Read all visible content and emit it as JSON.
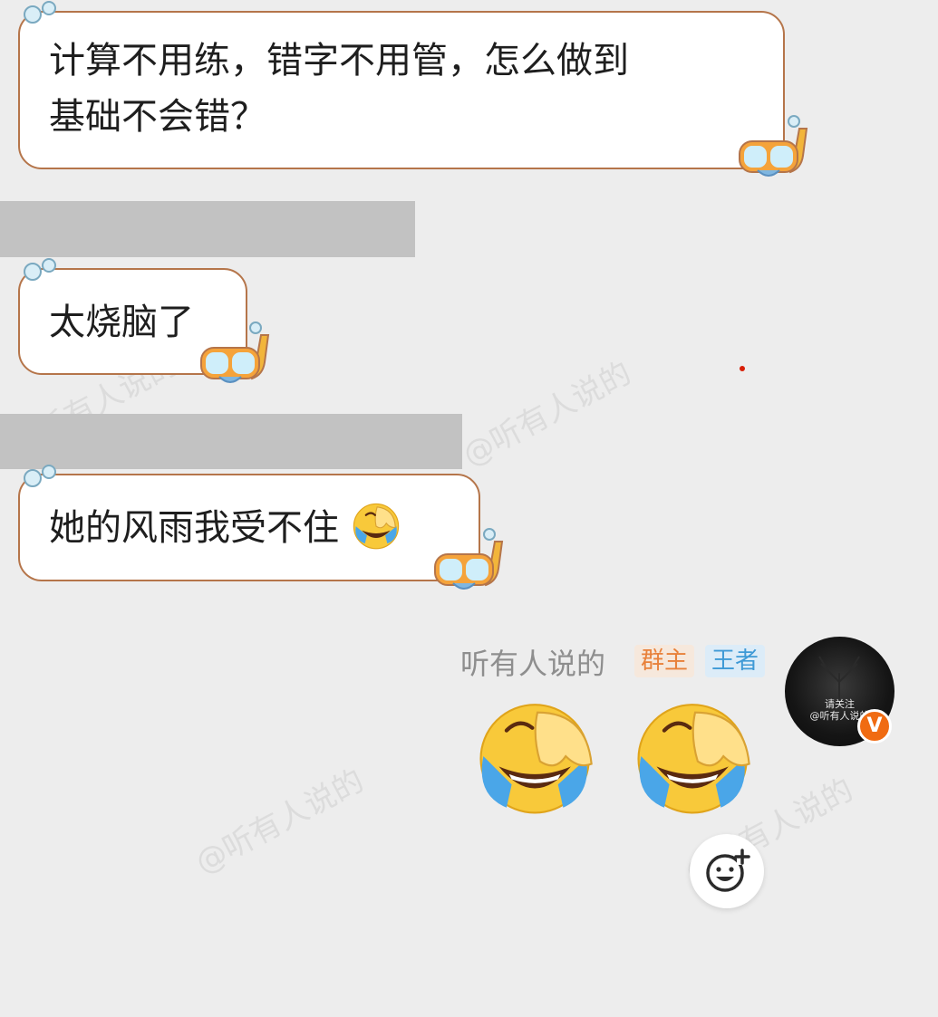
{
  "messages": [
    {
      "text_line1": "计算不用练，错字不用管，怎么做到",
      "text_line2": "基础不会错？"
    },
    {
      "text": "太烧脑了"
    },
    {
      "text": "她的风雨我受不住"
    }
  ],
  "sender": {
    "name": "听有人说的",
    "badges": {
      "owner": "群主",
      "rank": "王者"
    },
    "avatar": {
      "line1": "请关注",
      "line2": "@听有人说的",
      "badge_icon": "verified-v-icon",
      "badge_text": "V"
    },
    "stickers": [
      "face-palm-laughing-emoji",
      "face-palm-laughing-emoji"
    ]
  },
  "inline_emoji": "face-palm-laughing-emoji",
  "sticker_button_icon": "add-sticker-icon",
  "watermark": "@听有人说的",
  "colors": {
    "background": "#ededed",
    "bubble_border": "#b5754a",
    "owner_tag": "#e8813a",
    "rank_tag": "#3f9ad6",
    "badge": "#f06b12"
  }
}
